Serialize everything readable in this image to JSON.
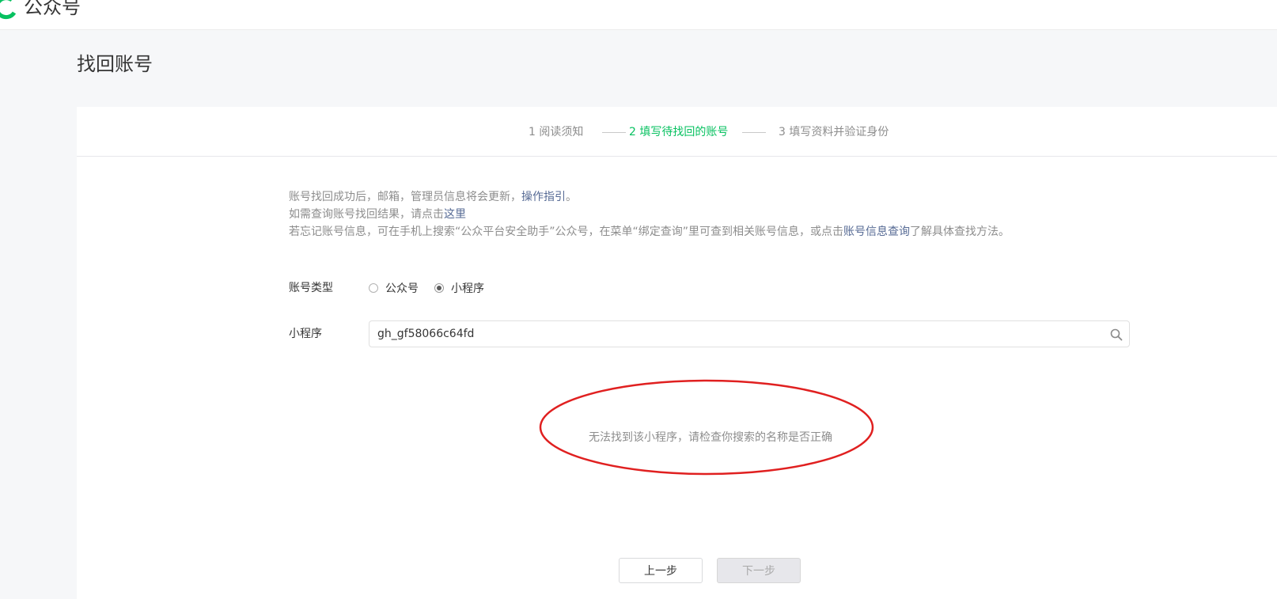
{
  "header": {
    "brand": "公众号"
  },
  "page": {
    "title": "找回账号"
  },
  "steps": [
    {
      "label": "1 阅读须知"
    },
    {
      "label": "2 填写待找回的账号"
    },
    {
      "label": "3 填写资料并验证身份"
    }
  ],
  "notice": {
    "line1_text": "账号找回成功后，邮箱，管理员信息将会更新，",
    "line1_link": "操作指引",
    "line1_end": "。",
    "line2_text": "如需查询账号找回结果，请点击",
    "line2_link": "这里",
    "line3_text": "若忘记账号信息，可在手机上搜索“公众平台安全助手”公众号，在菜单“绑定查询”里可查到相关账号信息，或点击",
    "line3_link": "账号信息查询",
    "line3_end": "了解具体查找方法。"
  },
  "form": {
    "account_type_label": "账号类型",
    "options": [
      {
        "label": "公众号",
        "checked": false
      },
      {
        "label": "小程序",
        "checked": true
      }
    ],
    "search_label": "小程序",
    "search_value": "gh_gf58066c64fd"
  },
  "result": {
    "message": "无法找到该小程序，请检查你搜索的名称是否正确"
  },
  "buttons": {
    "prev": "上一步",
    "next": "下一步"
  },
  "colors": {
    "accent": "#07c160",
    "link": "#576b95",
    "annotation": "#e02020"
  }
}
